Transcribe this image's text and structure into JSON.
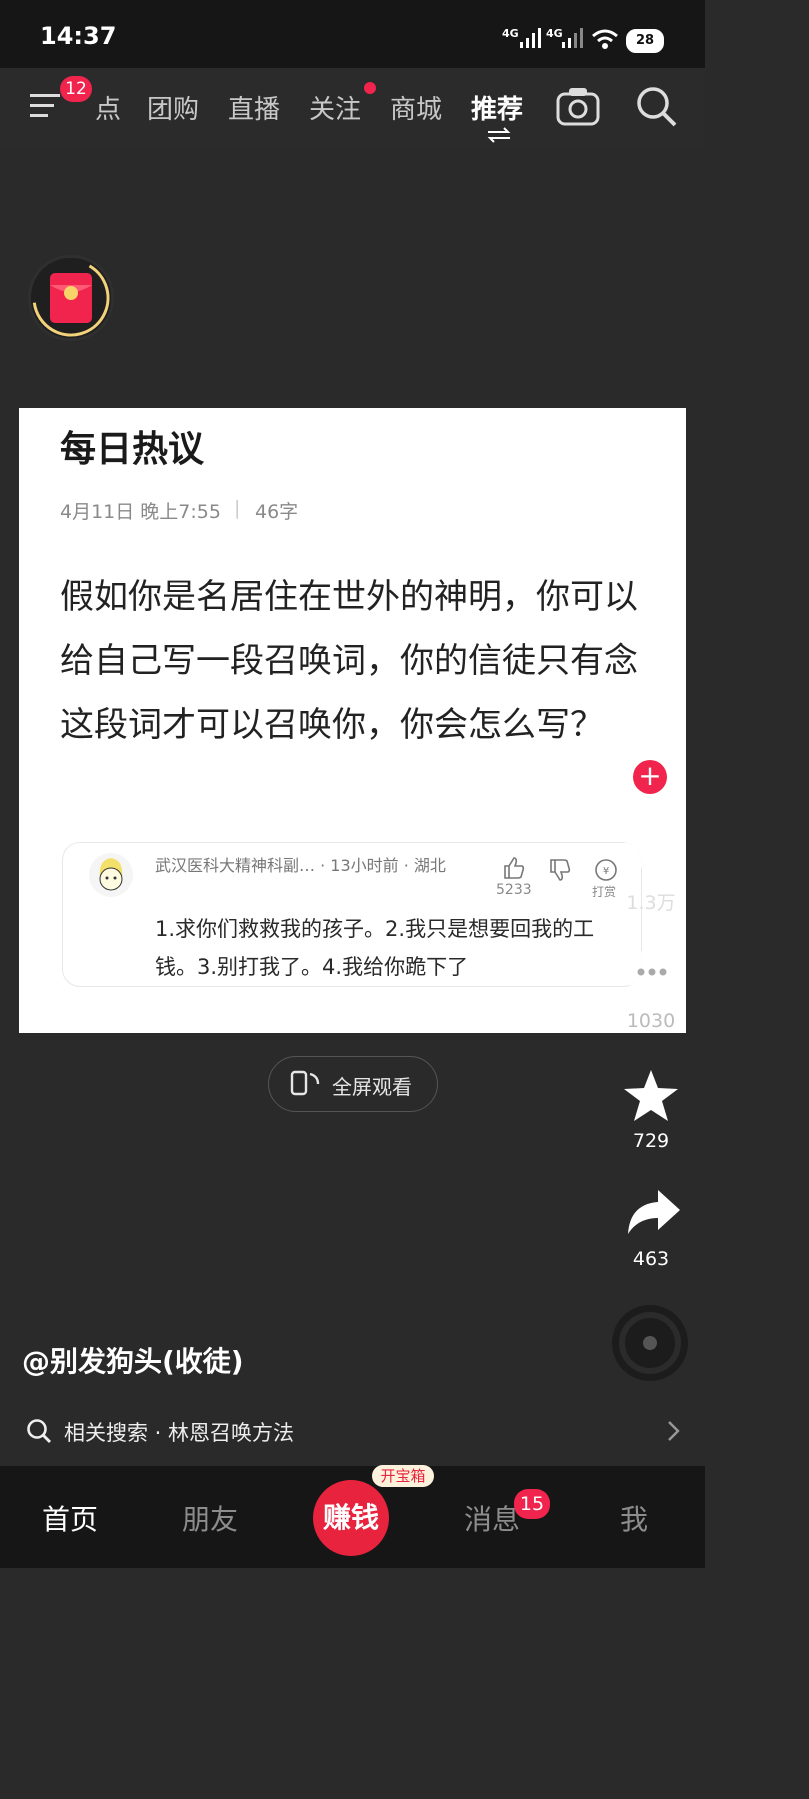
{
  "status": {
    "time": "14:37",
    "net1": "4G",
    "net2": "4G",
    "battery": "28"
  },
  "topnav": {
    "menu_badge": "12",
    "items": [
      "点",
      "团购",
      "直播",
      "关注",
      "商城",
      "推荐"
    ]
  },
  "card": {
    "title": "每日热议",
    "date": "4月11日 晚上7:55",
    "words": "46字",
    "question": "假如你是名居住在世外的神明，你可以给自己写一段召唤词，你的信徒只有念这段词才可以召唤你，你会怎么写？",
    "comment": {
      "author": "武汉医科大精神科副… · 13小时前 · 湖北",
      "likes": "5233",
      "tip_label": "打赏",
      "text": "1.求你们救救我的孩子。2.我只是想要回我的工钱。3.别打我了。4.我给你跪下了"
    }
  },
  "rail": {
    "likes": "1.3万",
    "comments": "1030",
    "favorites": "729",
    "shares": "463"
  },
  "fullscreen_label": "全屏观看",
  "video_author": "@别发狗头(收徒)",
  "related": {
    "label": "相关搜索 · 林恩召唤方法"
  },
  "bottomnav": {
    "home": "首页",
    "friends": "朋友",
    "earn": "赚钱",
    "earn_tag": "开宝箱",
    "messages": "消息",
    "messages_badge": "15",
    "me": "我"
  },
  "colors": {
    "accent": "#f0244c",
    "background": "#2a2a2a"
  }
}
